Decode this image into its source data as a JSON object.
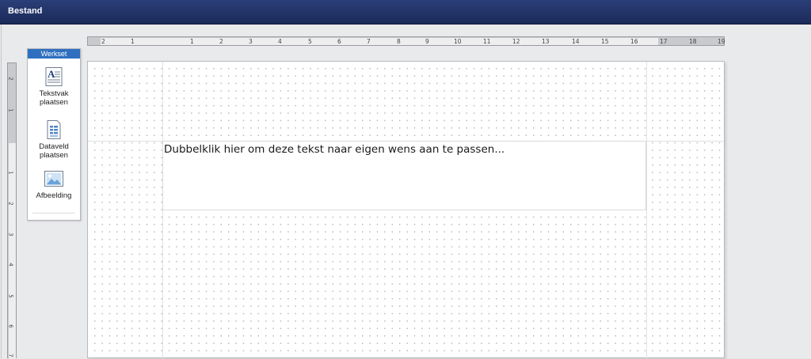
{
  "menu": {
    "file_label": "Bestand"
  },
  "toolbox": {
    "title": "Werkset",
    "items": [
      {
        "label_line1": "Tekstvak",
        "label_line2": "plaatsen",
        "icon": "textbox-icon"
      },
      {
        "label_line1": "Dataveld",
        "label_line2": "plaatsen",
        "icon": "datafield-icon"
      },
      {
        "label_line1": "Afbeelding",
        "label_line2": "",
        "icon": "image-icon"
      }
    ]
  },
  "ruler": {
    "horizontal_labels": [
      "2",
      "1",
      "1",
      "2",
      "3",
      "4",
      "5",
      "6",
      "7",
      "8",
      "9",
      "10",
      "11",
      "12",
      "13",
      "14",
      "15",
      "16",
      "17",
      "18",
      "19"
    ],
    "vertical_labels": [
      "2",
      "1",
      "1",
      "2",
      "3",
      "4",
      "5",
      "6",
      "7"
    ]
  },
  "canvas": {
    "textbox_text": "Dubbelklik hier om deze tekst naar eigen wens aan te passen..."
  },
  "colors": {
    "titlebar": "#1f2f63",
    "toolbox_header": "#2f6fc0",
    "workspace": "#e9eaec"
  }
}
